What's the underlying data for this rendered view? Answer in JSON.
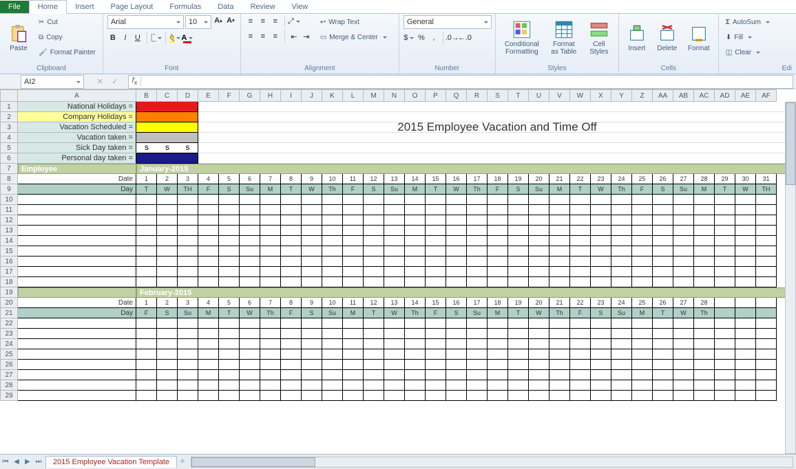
{
  "tabs": {
    "file": "File",
    "home": "Home",
    "insert": "Insert",
    "pagelayout": "Page Layout",
    "formulas": "Formulas",
    "data": "Data",
    "review": "Review",
    "view": "View"
  },
  "ribbon": {
    "clipboard": {
      "paste": "Paste",
      "cut": "Cut",
      "copy": "Copy",
      "painter": "Format Painter",
      "label": "Clipboard"
    },
    "font": {
      "name": "Arial",
      "size": "10",
      "label": "Font"
    },
    "alignment": {
      "wrap": "Wrap Text",
      "merge": "Merge & Center",
      "label": "Alignment"
    },
    "number": {
      "format": "General",
      "label": "Number"
    },
    "styles": {
      "cond": "Conditional Formatting",
      "table": "Format as Table",
      "cell": "Cell Styles",
      "label": "Styles"
    },
    "cells": {
      "insert": "Insert",
      "delete": "Delete",
      "format": "Format",
      "label": "Cells"
    },
    "editing": {
      "autosum": "AutoSum",
      "fill": "Fill",
      "clear": "Clear",
      "label": "Edi"
    }
  },
  "namebox": "AI2",
  "fx": "",
  "cols": [
    "A",
    "B",
    "C",
    "D",
    "E",
    "F",
    "G",
    "H",
    "I",
    "J",
    "K",
    "L",
    "M",
    "N",
    "O",
    "P",
    "Q",
    "R",
    "S",
    "T",
    "U",
    "V",
    "W",
    "X",
    "Y",
    "Z",
    "AA",
    "AB",
    "AC",
    "AD",
    "AE",
    "AF"
  ],
  "rows": [
    1,
    2,
    3,
    4,
    5,
    6,
    7,
    8,
    9,
    10,
    11,
    12,
    13,
    14,
    15,
    16,
    17,
    18,
    19,
    20,
    21,
    22,
    23,
    24,
    25,
    26,
    27,
    28,
    29
  ],
  "legend": [
    {
      "label": "National Holidays =",
      "color": "#e31a1c",
      "txt": ""
    },
    {
      "label": "Company Holidays =",
      "color": "#ff7f00",
      "txt": ""
    },
    {
      "label": "Vacation Scheduled =",
      "color": "#ffff00",
      "txt": ""
    },
    {
      "label": "Vacation taken =",
      "color": "#bfbfbf",
      "txt": ""
    },
    {
      "label": "Sick Day taken =",
      "color": "#ffffff",
      "txt": "S"
    },
    {
      "label": "Personal day taken =",
      "color": "#1a1a8a",
      "txt": ""
    }
  ],
  "title": "2015 Employee Vacation and Time Off",
  "emp_label": "Employee",
  "months": [
    {
      "name": "January-2015",
      "dates": [
        1,
        2,
        3,
        4,
        5,
        6,
        7,
        8,
        9,
        10,
        11,
        12,
        13,
        14,
        15,
        16,
        17,
        18,
        19,
        20,
        21,
        22,
        23,
        24,
        25,
        26,
        27,
        28,
        29,
        30,
        31
      ],
      "days": [
        "T",
        "W",
        "TH",
        "F",
        "S",
        "Su",
        "M",
        "T",
        "W",
        "Th",
        "F",
        "S",
        "Su",
        "M",
        "T",
        "W",
        "Th",
        "F",
        "S",
        "Su",
        "M",
        "T",
        "W",
        "Th",
        "F",
        "S",
        "Su",
        "M",
        "T",
        "W",
        "TH"
      ]
    },
    {
      "name": "February-2015",
      "dates": [
        1,
        2,
        3,
        4,
        5,
        6,
        7,
        8,
        9,
        10,
        11,
        12,
        13,
        14,
        15,
        16,
        17,
        18,
        19,
        20,
        21,
        22,
        23,
        24,
        25,
        26,
        27,
        28
      ],
      "days": [
        "F",
        "S",
        "Su",
        "M",
        "T",
        "W",
        "Th",
        "F",
        "S",
        "Su",
        "M",
        "T",
        "W",
        "Th",
        "F",
        "S",
        "Su",
        "M",
        "T",
        "W",
        "Th",
        "F",
        "S",
        "Su",
        "M",
        "T",
        "W",
        "Th"
      ]
    }
  ],
  "row_labels": {
    "date": "Date",
    "day": "Day"
  },
  "sheettab": "2015 Employee Vacation Template"
}
